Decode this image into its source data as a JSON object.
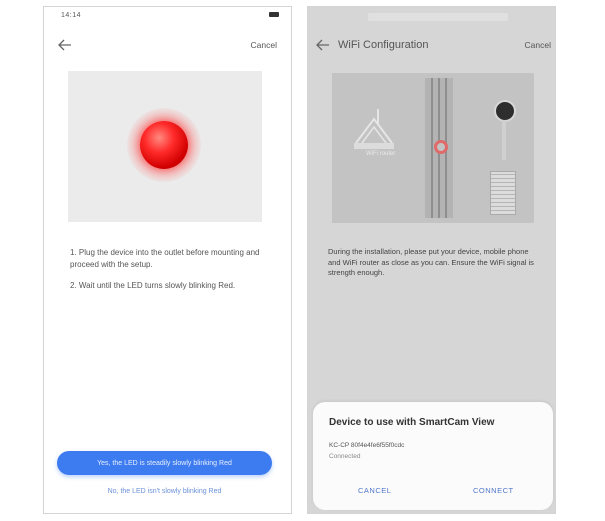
{
  "left_screen": {
    "status_time": "14:14",
    "nav": {
      "cancel_label": "Cancel"
    },
    "instructions": [
      "1. Plug the device into the outlet before mounting and proceed with the setup.",
      "2. Wait until the LED turns slowly blinking Red."
    ],
    "primary_button": "Yes, the LED is steadily slowly blinking Red",
    "secondary_link": "No, the LED isn't slowly blinking Red",
    "colors": {
      "accent": "#3d7bf0",
      "led": "#ff2a2a"
    }
  },
  "right_screen": {
    "nav": {
      "title": "WiFi Configuration",
      "cancel_label": "Cancel"
    },
    "router_label": "WiFi router",
    "info_text": "During the installation, please put your device, mobile phone and WiFi router as close as you can. Ensure the WiFi signal is strength enough.",
    "dialog": {
      "title": "Device to use with SmartCam View",
      "device_name": "KC-CP 80f4e4fe6f55f0cdc",
      "device_status": "Connected",
      "cancel_label": "CANCEL",
      "connect_label": "CONNECT"
    }
  }
}
